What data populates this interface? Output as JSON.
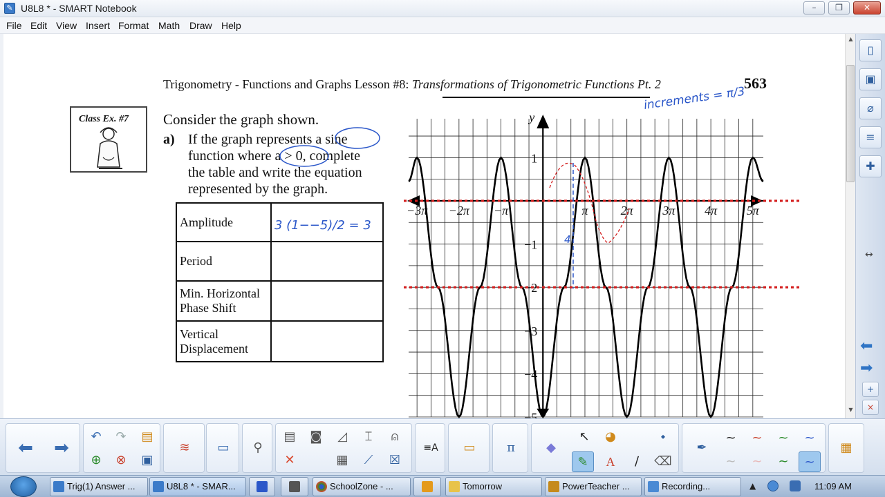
{
  "window": {
    "title": "U8L8 * - SMART Notebook",
    "minimize": "–",
    "restore": "❐",
    "close": "✕"
  },
  "menu": [
    "File",
    "Edit",
    "View",
    "Insert",
    "Format",
    "Math",
    "Draw",
    "Help"
  ],
  "page": {
    "header_plain": "Trigonometry - Functions and Graphs Lesson #8:",
    "header_italic": "Transformations of Trigonometric Functions Pt. 2",
    "page_number": "563",
    "class_ex": "Class Ex. #7",
    "prompt": "Consider the graph shown.",
    "part_label": "a)",
    "question_lines": [
      "If the graph represents a sine",
      "function where a > 0, complete",
      "the table and write the equation",
      "represented by the graph."
    ],
    "table": [
      {
        "label": "Amplitude",
        "value": ""
      },
      {
        "label": "Period",
        "value": ""
      },
      {
        "label": "Min. Horizontal Phase Shift",
        "value": ""
      },
      {
        "label": "Vertical Displacement",
        "value": ""
      }
    ],
    "handwriting": {
      "top_note": "increments = π/3",
      "amplitude_work": "3   (1−−5)/2 = 3",
      "amp_mark": "4"
    }
  },
  "chart_data": {
    "type": "line",
    "x_tick_labels": [
      "−3π",
      "−2π",
      "−π",
      "π",
      "2π",
      "3π",
      "4π",
      "5π"
    ],
    "y_tick_labels": [
      "1",
      "−1",
      "−2",
      "−3",
      "−4",
      "−5"
    ],
    "xlim": [
      -3.2,
      5.25
    ],
    "ylim": [
      -5,
      1.9
    ],
    "x_unit": "pi",
    "ylabel": "y",
    "series": [
      {
        "points": [
          [
            -3.2,
            0.45
          ],
          [
            -3,
            1
          ],
          [
            -2.5,
            -2
          ],
          [
            -2,
            -5
          ],
          [
            -1.5,
            -2
          ],
          [
            -1,
            1
          ],
          [
            -0.5,
            -2
          ],
          [
            0,
            -5
          ],
          [
            0.5,
            -2
          ],
          [
            1,
            1
          ],
          [
            1.5,
            -2
          ],
          [
            2,
            -5
          ],
          [
            2.5,
            -2
          ],
          [
            3,
            1
          ],
          [
            3.5,
            -2
          ],
          [
            4,
            -5
          ],
          [
            4.5,
            -2
          ],
          [
            5,
            1
          ],
          [
            5.25,
            0.45
          ]
        ],
        "color": "#000000"
      }
    ],
    "guide_lines_y": [
      0,
      -2
    ],
    "guide_color": "#d41c1c"
  },
  "toolbar": {
    "pi_label": "π",
    "text_label": "A"
  },
  "taskbar": {
    "items": [
      "Trig(1) Answer ...",
      "U8L8 * - SMAR...",
      "",
      "",
      "SchoolZone - ...",
      "",
      "Tomorrow",
      "PowerTeacher ...",
      "Recording..."
    ],
    "time": "11:09 AM"
  }
}
